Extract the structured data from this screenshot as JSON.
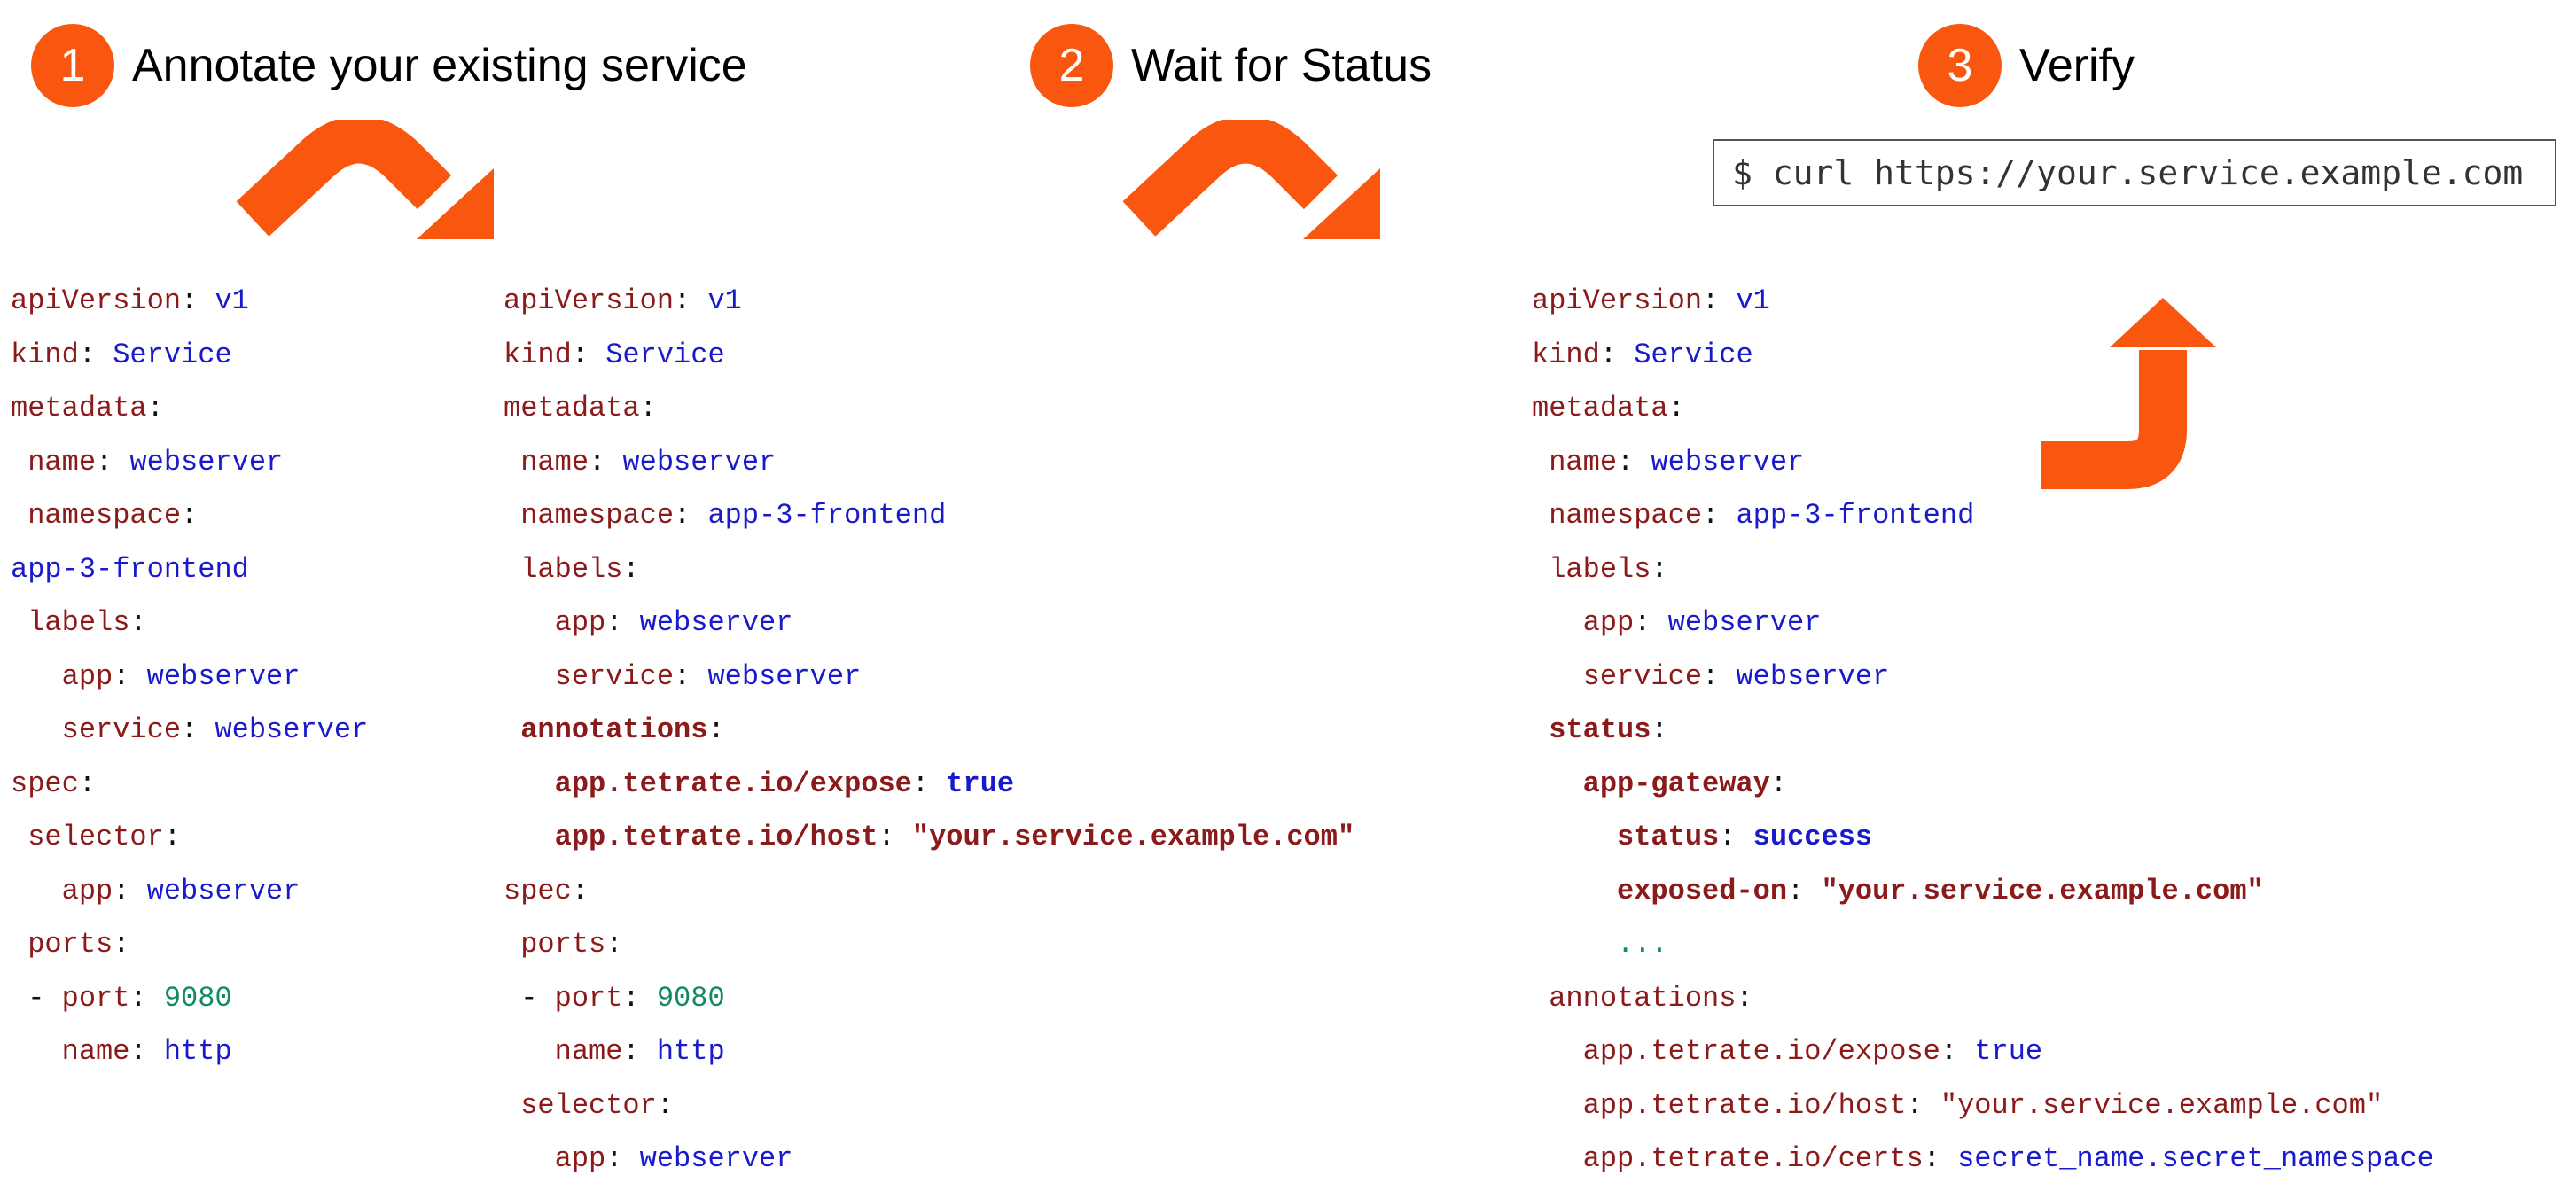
{
  "steps": [
    {
      "number": "1",
      "title": "Annotate your existing service"
    },
    {
      "number": "2",
      "title": "Wait for Status"
    },
    {
      "number": "3",
      "title": "Verify"
    }
  ],
  "verify_command": "$ curl https://your.service.example.com",
  "colors": {
    "accent": "#f9560f",
    "key": "#8b1a1a",
    "value": "#1a1acd",
    "number": "#138a63"
  },
  "panels": [
    {
      "name": "original-service",
      "lines": [
        [
          {
            "t": "apiVersion",
            "c": "k"
          },
          {
            "t": ": ",
            "c": "p"
          },
          {
            "t": "v1",
            "c": "v"
          }
        ],
        [
          {
            "t": "kind",
            "c": "k"
          },
          {
            "t": ": ",
            "c": "p"
          },
          {
            "t": "Service",
            "c": "v"
          }
        ],
        [
          {
            "t": "metadata",
            "c": "k"
          },
          {
            "t": ":",
            "c": "p"
          }
        ],
        [
          {
            "t": " name",
            "c": "k"
          },
          {
            "t": ": ",
            "c": "p"
          },
          {
            "t": "webserver",
            "c": "v"
          }
        ],
        [
          {
            "t": " namespace",
            "c": "k"
          },
          {
            "t": ":",
            "c": "p"
          }
        ],
        [
          {
            "t": "app-3-frontend",
            "c": "v"
          }
        ],
        [
          {
            "t": " labels",
            "c": "k"
          },
          {
            "t": ":",
            "c": "p"
          }
        ],
        [
          {
            "t": "   app",
            "c": "k"
          },
          {
            "t": ": ",
            "c": "p"
          },
          {
            "t": "webserver",
            "c": "v"
          }
        ],
        [
          {
            "t": "   service",
            "c": "k"
          },
          {
            "t": ": ",
            "c": "p"
          },
          {
            "t": "webserver",
            "c": "v"
          }
        ],
        [
          {
            "t": "spec",
            "c": "k"
          },
          {
            "t": ":",
            "c": "p"
          }
        ],
        [
          {
            "t": " selector",
            "c": "k"
          },
          {
            "t": ":",
            "c": "p"
          }
        ],
        [
          {
            "t": "   app",
            "c": "k"
          },
          {
            "t": ": ",
            "c": "p"
          },
          {
            "t": "webserver",
            "c": "v"
          }
        ],
        [
          {
            "t": " ports",
            "c": "k"
          },
          {
            "t": ":",
            "c": "p"
          }
        ],
        [
          {
            "t": " - ",
            "c": "p"
          },
          {
            "t": "port",
            "c": "k"
          },
          {
            "t": ": ",
            "c": "p"
          },
          {
            "t": "9080",
            "c": "n"
          }
        ],
        [
          {
            "t": "   name",
            "c": "k"
          },
          {
            "t": ": ",
            "c": "p"
          },
          {
            "t": "http",
            "c": "v"
          }
        ]
      ]
    },
    {
      "name": "annotated-service",
      "lines": [
        [
          {
            "t": "apiVersion",
            "c": "k"
          },
          {
            "t": ": ",
            "c": "p"
          },
          {
            "t": "v1",
            "c": "v"
          }
        ],
        [
          {
            "t": "kind",
            "c": "k"
          },
          {
            "t": ": ",
            "c": "p"
          },
          {
            "t": "Service",
            "c": "v"
          }
        ],
        [
          {
            "t": "metadata",
            "c": "k"
          },
          {
            "t": ":",
            "c": "p"
          }
        ],
        [
          {
            "t": " name",
            "c": "k"
          },
          {
            "t": ": ",
            "c": "p"
          },
          {
            "t": "webserver",
            "c": "v"
          }
        ],
        [
          {
            "t": " namespace",
            "c": "k"
          },
          {
            "t": ": ",
            "c": "p"
          },
          {
            "t": "app-3-frontend",
            "c": "v"
          }
        ],
        [
          {
            "t": " labels",
            "c": "k"
          },
          {
            "t": ":",
            "c": "p"
          }
        ],
        [
          {
            "t": "   app",
            "c": "k"
          },
          {
            "t": ": ",
            "c": "p"
          },
          {
            "t": "webserver",
            "c": "v"
          }
        ],
        [
          {
            "t": "   service",
            "c": "k"
          },
          {
            "t": ": ",
            "c": "p"
          },
          {
            "t": "webserver",
            "c": "v"
          }
        ],
        [
          {
            "t": " annotations",
            "c": "k",
            "b": true
          },
          {
            "t": ":",
            "c": "p"
          }
        ],
        [
          {
            "t": "   app.tetrate.io/expose",
            "c": "k",
            "b": true
          },
          {
            "t": ": ",
            "c": "p"
          },
          {
            "t": "true",
            "c": "v",
            "b": true
          }
        ],
        [
          {
            "t": "   app.tetrate.io/host",
            "c": "k",
            "b": true
          },
          {
            "t": ": ",
            "c": "p"
          },
          {
            "t": "\"your.service.example.com\"",
            "c": "s",
            "b": true
          }
        ],
        [
          {
            "t": "spec",
            "c": "k"
          },
          {
            "t": ":",
            "c": "p"
          }
        ],
        [
          {
            "t": " ports",
            "c": "k"
          },
          {
            "t": ":",
            "c": "p"
          }
        ],
        [
          {
            "t": " - ",
            "c": "p"
          },
          {
            "t": "port",
            "c": "k"
          },
          {
            "t": ": ",
            "c": "p"
          },
          {
            "t": "9080",
            "c": "n"
          }
        ],
        [
          {
            "t": "   name",
            "c": "k"
          },
          {
            "t": ": ",
            "c": "p"
          },
          {
            "t": "http",
            "c": "v"
          }
        ],
        [
          {
            "t": " selector",
            "c": "k"
          },
          {
            "t": ":",
            "c": "p"
          }
        ],
        [
          {
            "t": "   app",
            "c": "k"
          },
          {
            "t": ": ",
            "c": "p"
          },
          {
            "t": "webserver",
            "c": "v"
          }
        ]
      ]
    },
    {
      "name": "status-service",
      "lines": [
        [
          {
            "t": "apiVersion",
            "c": "k"
          },
          {
            "t": ": ",
            "c": "p"
          },
          {
            "t": "v1",
            "c": "v"
          }
        ],
        [
          {
            "t": "kind",
            "c": "k"
          },
          {
            "t": ": ",
            "c": "p"
          },
          {
            "t": "Service",
            "c": "v"
          }
        ],
        [
          {
            "t": "metadata",
            "c": "k"
          },
          {
            "t": ":",
            "c": "p"
          }
        ],
        [
          {
            "t": " name",
            "c": "k"
          },
          {
            "t": ": ",
            "c": "p"
          },
          {
            "t": "webserver",
            "c": "v"
          }
        ],
        [
          {
            "t": " namespace",
            "c": "k"
          },
          {
            "t": ": ",
            "c": "p"
          },
          {
            "t": "app-3-frontend",
            "c": "v"
          }
        ],
        [
          {
            "t": " labels",
            "c": "k"
          },
          {
            "t": ":",
            "c": "p"
          }
        ],
        [
          {
            "t": "   app",
            "c": "k"
          },
          {
            "t": ": ",
            "c": "p"
          },
          {
            "t": "webserver",
            "c": "v"
          }
        ],
        [
          {
            "t": "   service",
            "c": "k"
          },
          {
            "t": ": ",
            "c": "p"
          },
          {
            "t": "webserver",
            "c": "v"
          }
        ],
        [
          {
            "t": " status",
            "c": "k",
            "b": true
          },
          {
            "t": ":",
            "c": "p"
          }
        ],
        [
          {
            "t": "   app-gateway",
            "c": "k",
            "b": true
          },
          {
            "t": ":",
            "c": "p"
          }
        ],
        [
          {
            "t": "     status",
            "c": "k",
            "b": true
          },
          {
            "t": ": ",
            "c": "p"
          },
          {
            "t": "success",
            "c": "v",
            "b": true
          }
        ],
        [
          {
            "t": "     exposed-on",
            "c": "k",
            "b": true
          },
          {
            "t": ": ",
            "c": "p"
          },
          {
            "t": "\"your.service.example.com\"",
            "c": "s",
            "b": true
          }
        ],
        [
          {
            "t": "     ...",
            "c": "n"
          }
        ],
        [
          {
            "t": " annotations",
            "c": "k"
          },
          {
            "t": ":",
            "c": "p"
          }
        ],
        [
          {
            "t": "   app.tetrate.io/expose",
            "c": "k"
          },
          {
            "t": ": ",
            "c": "p"
          },
          {
            "t": "true",
            "c": "v"
          }
        ],
        [
          {
            "t": "   app.tetrate.io/host",
            "c": "k"
          },
          {
            "t": ": ",
            "c": "p"
          },
          {
            "t": "\"your.service.example.com\"",
            "c": "s"
          }
        ],
        [
          {
            "t": "   app.tetrate.io/certs",
            "c": "k"
          },
          {
            "t": ": ",
            "c": "p"
          },
          {
            "t": "secret_name.secret_namespace",
            "c": "v"
          }
        ]
      ]
    }
  ]
}
